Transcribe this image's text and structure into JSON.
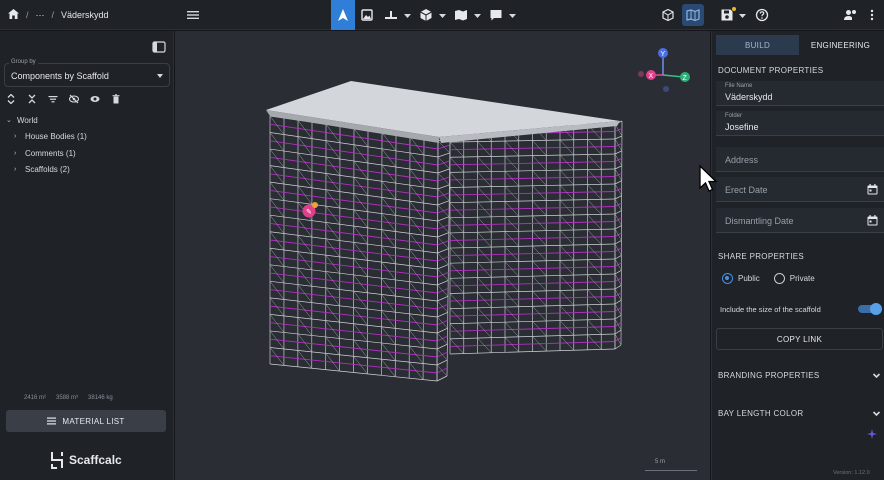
{
  "breadcrumb": {
    "home_icon": "home-icon",
    "ellipsis": "···",
    "sep1": "/",
    "sep2": "/",
    "project": "Väderskydd"
  },
  "toolbar": {
    "tools": [
      "navigate-arrow-icon",
      "image-icon",
      "level-icon",
      "box-icon",
      "map-icon",
      "comment-icon"
    ],
    "right_icons": [
      "cube-view-icon",
      "map-view-icon",
      "save-icon",
      "help-icon",
      "user-settings-icon"
    ]
  },
  "left_panel": {
    "group_by_label": "Group by",
    "group_by_value": "Components by Scaffold",
    "tree": [
      {
        "label": "World",
        "level": 0
      },
      {
        "label": "House Bodies (1)",
        "level": 1
      },
      {
        "label": "Comments (1)",
        "level": 1
      },
      {
        "label": "Scaffolds (2)",
        "level": 1
      }
    ],
    "stats": {
      "area": "2416 m²",
      "volume": "3588 m³",
      "weight": "38146 kg"
    },
    "material_list_label": "MATERIAL LIST",
    "logo_text": "Scaffcalc"
  },
  "viewport": {
    "scale_label": "5 m",
    "axes": {
      "y": "Y",
      "x": "X",
      "z": "Z"
    },
    "comment_marker": "comment-marker-icon"
  },
  "right_panel": {
    "tabs": [
      {
        "label": "BUILD",
        "active": true
      },
      {
        "label": "ENGINEERING",
        "active": false
      }
    ],
    "document_properties_title": "DOCUMENT PROPERTIES",
    "fields": {
      "file_name": {
        "label": "File Name",
        "value": "Väderskydd"
      },
      "folder": {
        "label": "Folder",
        "value": "Josefine"
      },
      "address": {
        "placeholder": "Address"
      },
      "erect_date": {
        "placeholder": "Erect Date"
      },
      "dismantling_date": {
        "placeholder": "Dismantling Date"
      }
    },
    "share_properties_title": "SHARE PROPERTIES",
    "share_options": {
      "public": "Public",
      "private": "Private",
      "selected": "Public"
    },
    "include_size_label": "Include the size of the scaffold",
    "include_size_enabled": true,
    "copy_link_label": "COPY LINK",
    "branding_properties_title": "BRANDING PROPERTIES",
    "bay_length_color_title": "BAY LENGTH COLOR",
    "version": "Version: 1.12.0"
  },
  "colors": {
    "accent": "#2f7ed8",
    "magenta_rail": "#b030c0",
    "panel": "#1f2227",
    "viewport": "#2a2d33"
  }
}
